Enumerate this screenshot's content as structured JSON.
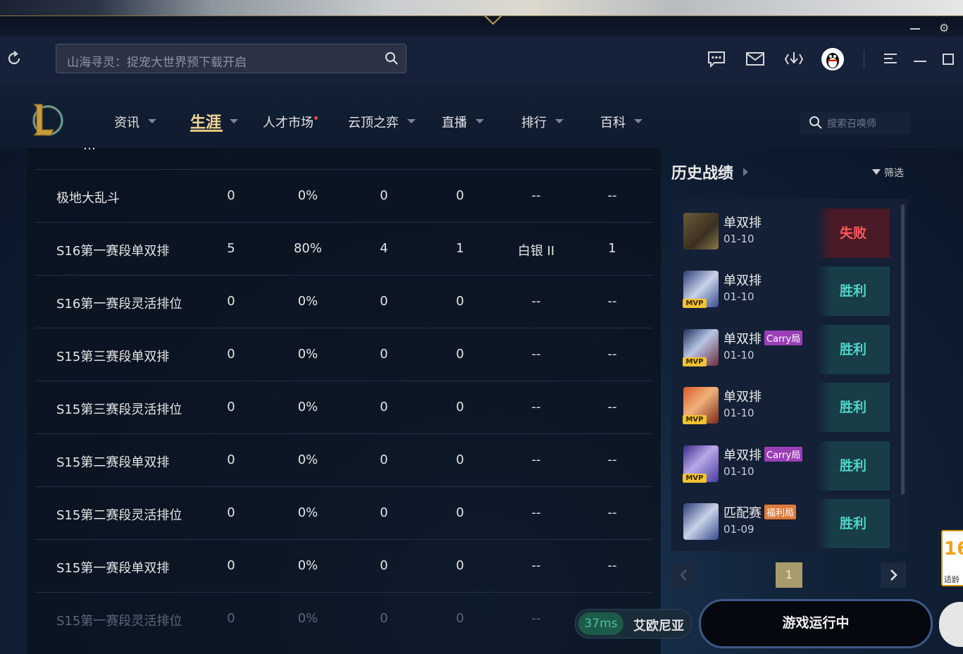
{
  "header": {
    "search_placeholder": "山海寻灵：捉宠大世界预下载开启",
    "icons": [
      "refresh-icon",
      "search-icon",
      "chat-icon",
      "mail-icon",
      "download-icon",
      "qq-avatar",
      "menu-icon",
      "minimize-icon",
      "maximize-icon"
    ]
  },
  "nav": {
    "items": [
      {
        "label": "资讯",
        "caret": true
      },
      {
        "label": "生涯",
        "caret": true,
        "active": true
      },
      {
        "label": "人才市场",
        "dot": true
      },
      {
        "label": "云顶之弈",
        "caret": true
      },
      {
        "label": "直播",
        "caret": true
      },
      {
        "label": "排行",
        "caret": true
      },
      {
        "label": "百科",
        "caret": true
      }
    ],
    "summoner_search_placeholder": "搜索召唤师"
  },
  "table": {
    "rows": [
      {
        "mode": "极地大乱斗",
        "games": "0",
        "winrate": "0%",
        "wins": "0",
        "losses": "0",
        "rank": "--",
        "last": "--"
      },
      {
        "mode": "S16第一赛段单双排",
        "games": "5",
        "winrate": "80%",
        "wins": "4",
        "losses": "1",
        "rank": "白银 II",
        "last": "1"
      },
      {
        "mode": "S16第一赛段灵活排位",
        "games": "0",
        "winrate": "0%",
        "wins": "0",
        "losses": "0",
        "rank": "--",
        "last": "--"
      },
      {
        "mode": "S15第三赛段单双排",
        "games": "0",
        "winrate": "0%",
        "wins": "0",
        "losses": "0",
        "rank": "--",
        "last": "--"
      },
      {
        "mode": "S15第三赛段灵活排位",
        "games": "0",
        "winrate": "0%",
        "wins": "0",
        "losses": "0",
        "rank": "--",
        "last": "--"
      },
      {
        "mode": "S15第二赛段单双排",
        "games": "0",
        "winrate": "0%",
        "wins": "0",
        "losses": "0",
        "rank": "--",
        "last": "--"
      },
      {
        "mode": "S15第二赛段灵活排位",
        "games": "0",
        "winrate": "0%",
        "wins": "0",
        "losses": "0",
        "rank": "--",
        "last": "--"
      },
      {
        "mode": "S15第一赛段单双排",
        "games": "0",
        "winrate": "0%",
        "wins": "0",
        "losses": "0",
        "rank": "--",
        "last": "--"
      },
      {
        "mode": "S15第一赛段灵活排位",
        "games": "0",
        "winrate": "0%",
        "wins": "0",
        "losses": "0",
        "rank": "--",
        "last": "--"
      }
    ]
  },
  "history": {
    "title": "历史战绩",
    "filter_label": "筛选",
    "matches": [
      {
        "mode": "单双排",
        "date": "01-10",
        "result": "失败",
        "win": false,
        "mvp": false,
        "tag": ""
      },
      {
        "mode": "单双排",
        "date": "01-10",
        "result": "胜利",
        "win": true,
        "mvp": true,
        "tag": ""
      },
      {
        "mode": "单双排",
        "date": "01-10",
        "result": "胜利",
        "win": true,
        "mvp": true,
        "tag": "Carry局",
        "tag_color": "#9b3fb7"
      },
      {
        "mode": "单双排",
        "date": "01-10",
        "result": "胜利",
        "win": true,
        "mvp": true,
        "tag": ""
      },
      {
        "mode": "单双排",
        "date": "01-10",
        "result": "胜利",
        "win": true,
        "mvp": true,
        "tag": "Carry局",
        "tag_color": "#9b3fb7"
      },
      {
        "mode": "匹配赛",
        "date": "01-09",
        "result": "胜利",
        "win": true,
        "mvp": false,
        "tag": "福利局",
        "tag_color": "#e07a3a"
      }
    ],
    "mvp_label": "MVP",
    "page": "1"
  },
  "status": {
    "ping": "37ms",
    "server": "艾欧尼亚",
    "play_button": "游戏运行中"
  },
  "age_badge": {
    "number": "16",
    "text": "适龄"
  },
  "colors": {
    "accent_gold": "#e2c27a",
    "win": "#4fd6c8",
    "lose": "#ff5a5a",
    "background": "#0d1626"
  }
}
